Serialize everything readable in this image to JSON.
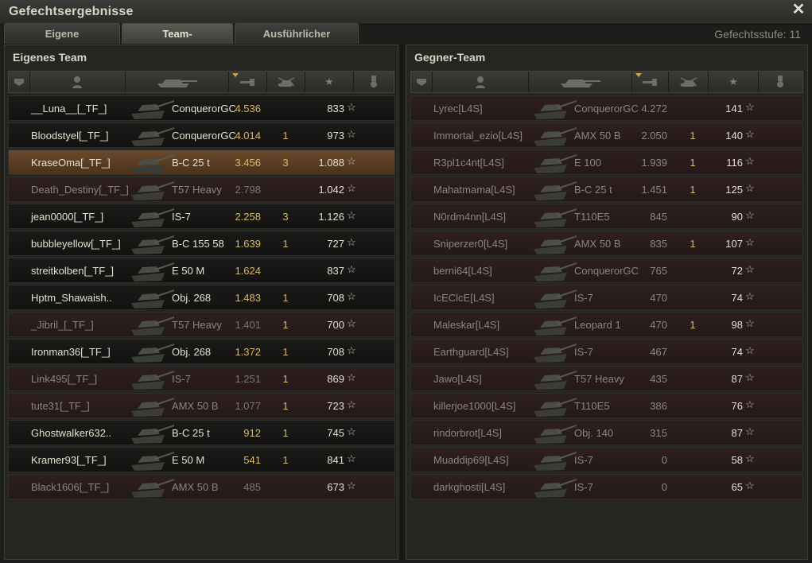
{
  "window": {
    "title": "Gefechtsergebnisse",
    "close_icon": "close-icon"
  },
  "tabs": [
    {
      "label": "Eigene Auswertung",
      "active": false
    },
    {
      "label": "Team-Auswertung",
      "active": true
    },
    {
      "label": "Ausführlicher Bericht",
      "active": false
    }
  ],
  "battle_level": "Gefechtsstufe: 11",
  "own_team": {
    "title": "Eigenes Team",
    "headers": [
      "squad-icon",
      "player-icon",
      "tank-icon",
      "damage-icon",
      "kills-icon",
      "xp-star-icon",
      "medal-icon"
    ],
    "rows": [
      {
        "name": "__Luna__[_TF_]",
        "tank": "ConquerorGC",
        "dmg": "4.536",
        "kills": "",
        "xp": "833",
        "dead": false,
        "self": false
      },
      {
        "name": "Bloodstyel[_TF_]",
        "tank": "ConquerorGC",
        "dmg": "4.014",
        "kills": "1",
        "xp": "973",
        "dead": false,
        "self": false
      },
      {
        "name": "KraseOma[_TF_]",
        "tank": "B-C 25 t",
        "dmg": "3.456",
        "kills": "3",
        "xp": "1.088",
        "dead": false,
        "self": true
      },
      {
        "name": "Death_Destiny[_TF_]",
        "tank": "T57 Heavy",
        "dmg": "2.798",
        "kills": "",
        "xp": "1.042",
        "dead": true,
        "self": false
      },
      {
        "name": "jean0000[_TF_]",
        "tank": "IS-7",
        "dmg": "2.258",
        "kills": "3",
        "xp": "1.126",
        "dead": false,
        "self": false
      },
      {
        "name": "bubbleyellow[_TF_]",
        "tank": "B-C 155 58",
        "dmg": "1.639",
        "kills": "1",
        "xp": "727",
        "dead": false,
        "self": false
      },
      {
        "name": "streitkolben[_TF_]",
        "tank": "E 50 M",
        "dmg": "1.624",
        "kills": "",
        "xp": "837",
        "dead": false,
        "self": false
      },
      {
        "name": "Hptm_Shawaish..",
        "tank": "Obj. 268",
        "dmg": "1.483",
        "kills": "1",
        "xp": "708",
        "dead": false,
        "self": false
      },
      {
        "name": "_Jibril_[_TF_]",
        "tank": "T57 Heavy",
        "dmg": "1.401",
        "kills": "1",
        "xp": "700",
        "dead": true,
        "self": false
      },
      {
        "name": "Ironman36[_TF_]",
        "tank": "Obj. 268",
        "dmg": "1.372",
        "kills": "1",
        "xp": "708",
        "dead": false,
        "self": false
      },
      {
        "name": "Link495[_TF_]",
        "tank": "IS-7",
        "dmg": "1.251",
        "kills": "1",
        "xp": "869",
        "dead": true,
        "self": false
      },
      {
        "name": "tute31[_TF_]",
        "tank": "AMX 50 B",
        "dmg": "1.077",
        "kills": "1",
        "xp": "723",
        "dead": true,
        "self": false
      },
      {
        "name": "Ghostwalker632..",
        "tank": "B-C 25 t",
        "dmg": "912",
        "kills": "1",
        "xp": "745",
        "dead": false,
        "self": false
      },
      {
        "name": "Kramer93[_TF_]",
        "tank": "E 50 M",
        "dmg": "541",
        "kills": "1",
        "xp": "841",
        "dead": false,
        "self": false
      },
      {
        "name": "Black1606[_TF_]",
        "tank": "AMX 50 B",
        "dmg": "485",
        "kills": "",
        "xp": "673",
        "dead": true,
        "self": false
      }
    ]
  },
  "enemy_team": {
    "title": "Gegner-Team",
    "rows": [
      {
        "name": "Lyrec[L4S]",
        "tank": "ConquerorGC",
        "dmg": "4.272",
        "kills": "",
        "xp": "141"
      },
      {
        "name": "Immortal_ezio[L4S]",
        "tank": "AMX 50 B",
        "dmg": "2.050",
        "kills": "1",
        "xp": "140"
      },
      {
        "name": "R3pl1c4nt[L4S]",
        "tank": "E 100",
        "dmg": "1.939",
        "kills": "1",
        "xp": "116"
      },
      {
        "name": "Mahatmama[L4S]",
        "tank": "B-C 25 t",
        "dmg": "1.451",
        "kills": "1",
        "xp": "125"
      },
      {
        "name": "N0rdm4nn[L4S]",
        "tank": "T110E5",
        "dmg": "845",
        "kills": "",
        "xp": "90"
      },
      {
        "name": "Sniperzer0[L4S]",
        "tank": "AMX 50 B",
        "dmg": "835",
        "kills": "1",
        "xp": "107"
      },
      {
        "name": "berni64[L4S]",
        "tank": "ConquerorGC",
        "dmg": "765",
        "kills": "",
        "xp": "72"
      },
      {
        "name": "IcEClcE[L4S]",
        "tank": "IS-7",
        "dmg": "470",
        "kills": "",
        "xp": "74"
      },
      {
        "name": "Maleskar[L4S]",
        "tank": "Leopard 1",
        "dmg": "470",
        "kills": "1",
        "xp": "98"
      },
      {
        "name": "Earthguard[L4S]",
        "tank": "IS-7",
        "dmg": "467",
        "kills": "",
        "xp": "74"
      },
      {
        "name": "Jawo[L4S]",
        "tank": "T57 Heavy",
        "dmg": "435",
        "kills": "",
        "xp": "87"
      },
      {
        "name": "killerjoe1000[L4S]",
        "tank": "T110E5",
        "dmg": "386",
        "kills": "",
        "xp": "76"
      },
      {
        "name": "rindorbrot[L4S]",
        "tank": "Obj. 140",
        "dmg": "315",
        "kills": "",
        "xp": "87"
      },
      {
        "name": "Muaddip69[L4S]",
        "tank": "IS-7",
        "dmg": "0",
        "kills": "",
        "xp": "58"
      },
      {
        "name": "darkghosti[L4S]",
        "tank": "IS-7",
        "dmg": "0",
        "kills": "",
        "xp": "65"
      }
    ]
  }
}
